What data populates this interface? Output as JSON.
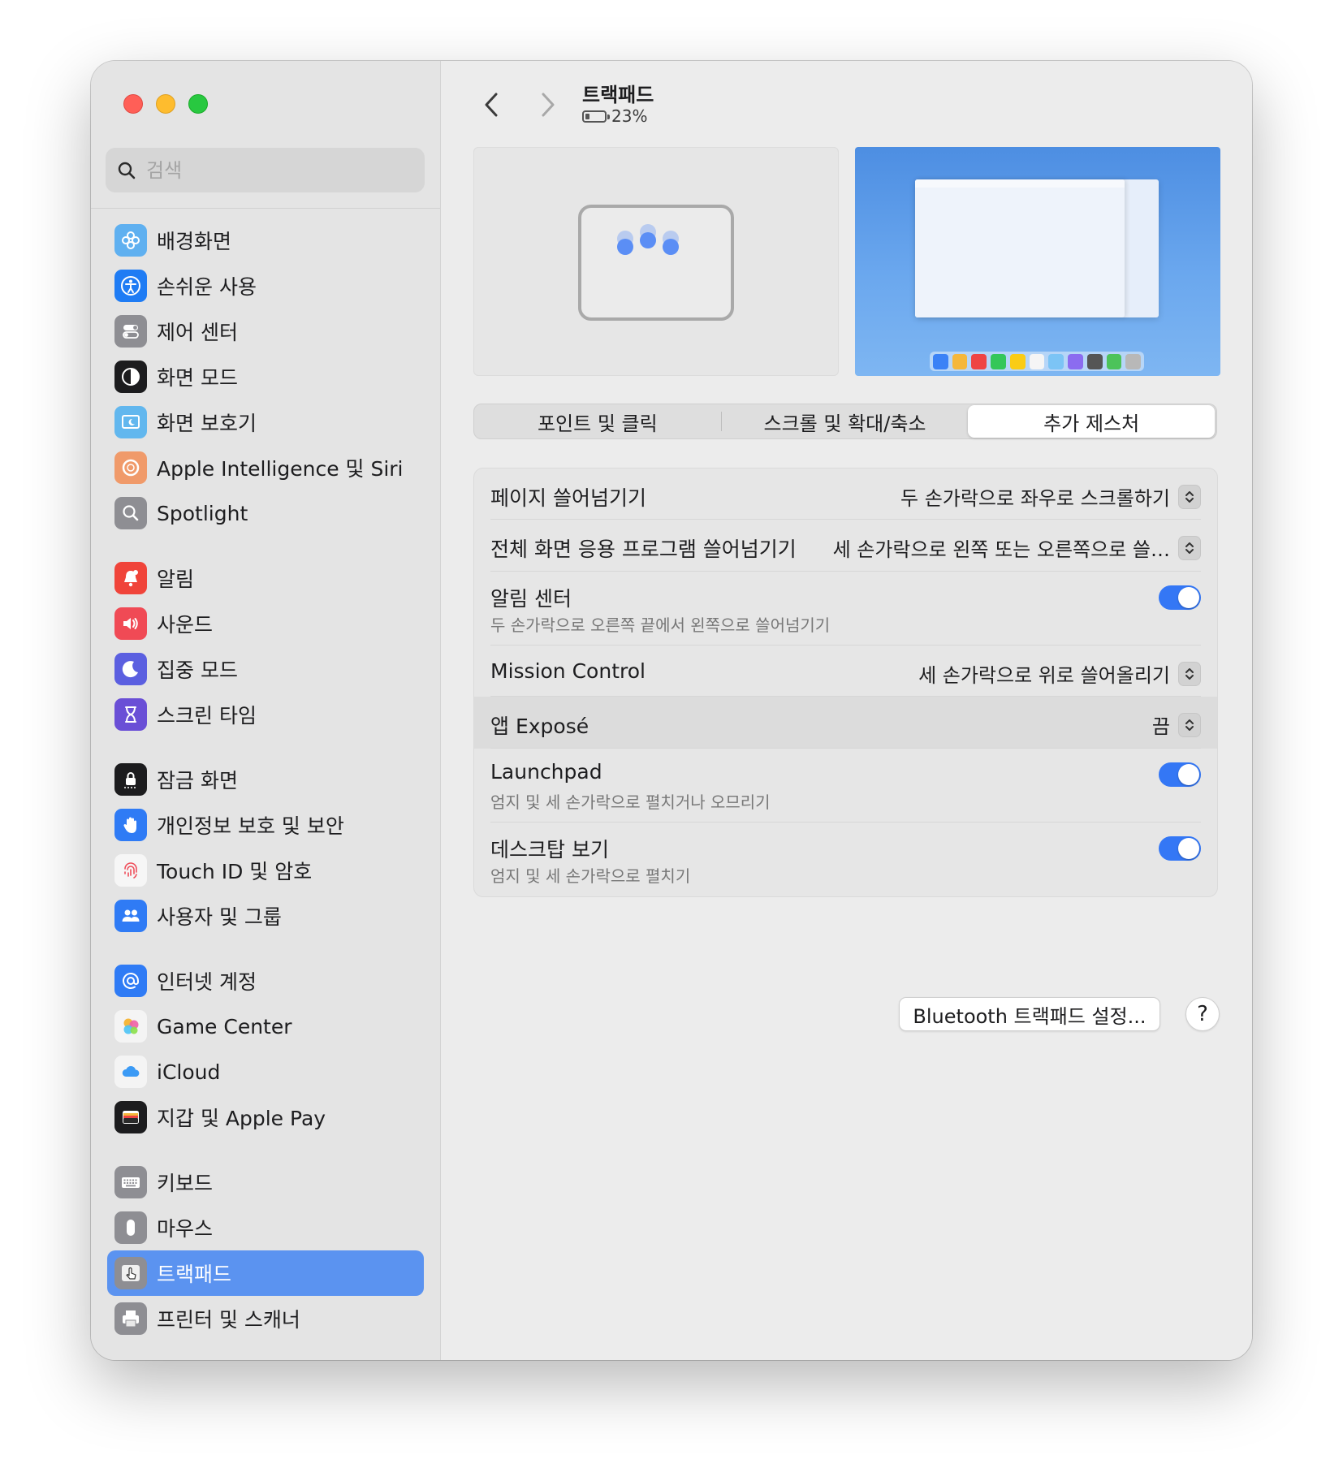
{
  "window": {
    "title": "트랙패드",
    "battery": "23%",
    "battery_level": 0.23
  },
  "search": {
    "placeholder": "검색"
  },
  "sidebar": {
    "groups": [
      [
        {
          "label": "배경화면",
          "icon": "wallpaper-icon",
          "color": "#5fb0f0"
        },
        {
          "label": "손쉬운 사용",
          "icon": "accessibility-icon",
          "color": "#1f7cf4"
        },
        {
          "label": "제어 센터",
          "icon": "control-center-icon",
          "color": "#8e8e93"
        },
        {
          "label": "화면 모드",
          "icon": "appearance-icon",
          "color": "#1c1c1e"
        },
        {
          "label": "화면 보호기",
          "icon": "screensaver-icon",
          "color": "#62b7ee"
        },
        {
          "label": "Apple Intelligence 및 Siri",
          "icon": "siri-icon",
          "color": "#f09a6a"
        },
        {
          "label": "Spotlight",
          "icon": "spotlight-icon",
          "color": "#8e8e93"
        }
      ],
      [
        {
          "label": "알림",
          "icon": "notifications-icon",
          "color": "#f0443a"
        },
        {
          "label": "사운드",
          "icon": "sound-icon",
          "color": "#f04a55"
        },
        {
          "label": "집중 모드",
          "icon": "focus-icon",
          "color": "#5b5fe0"
        },
        {
          "label": "스크린 타임",
          "icon": "screen-time-icon",
          "color": "#6a4fd6"
        }
      ],
      [
        {
          "label": "잠금 화면",
          "icon": "lock-screen-icon",
          "color": "#1c1c1e"
        },
        {
          "label": "개인정보 보호 및 보안",
          "icon": "privacy-hand-icon",
          "color": "#2f7bf5"
        },
        {
          "label": "Touch ID 및 암호",
          "icon": "fingerprint-icon",
          "color": "#f6f6f6"
        },
        {
          "label": "사용자 및 그룹",
          "icon": "users-icon",
          "color": "#2f7bf5"
        }
      ],
      [
        {
          "label": "인터넷 계정",
          "icon": "at-icon",
          "color": "#2f7bf5"
        },
        {
          "label": "Game Center",
          "icon": "game-center-icon",
          "color": "#f4f4f4"
        },
        {
          "label": "iCloud",
          "icon": "icloud-icon",
          "color": "#f4f4f4"
        },
        {
          "label": "지갑 및 Apple Pay",
          "icon": "wallet-icon",
          "color": "#1c1c1e"
        }
      ],
      [
        {
          "label": "키보드",
          "icon": "keyboard-icon",
          "color": "#8e8e93"
        },
        {
          "label": "마우스",
          "icon": "mouse-icon",
          "color": "#8e8e93"
        },
        {
          "label": "트랙패드",
          "icon": "trackpad-icon",
          "color": "#8e8e93",
          "selected": true
        },
        {
          "label": "프린터 및 스캐너",
          "icon": "printer-icon",
          "color": "#8e8e93"
        }
      ]
    ]
  },
  "tabs": [
    {
      "label": "포인트 및 클릭",
      "active": false
    },
    {
      "label": "스크롤 및 확대/축소",
      "active": false
    },
    {
      "label": "추가 제스처",
      "active": true
    }
  ],
  "settings": [
    {
      "label": "페이지 쓸어넘기기",
      "type": "popup",
      "value": "두 손가락으로 좌우로 스크롤하기"
    },
    {
      "label": "전체 화면 응용 프로그램 쓸어넘기기",
      "type": "popup",
      "value": "세 손가락으로 왼쪽 또는 오른쪽으로 쓸…"
    },
    {
      "label": "알림 센터",
      "type": "toggle",
      "on": true,
      "subtitle": "두 손가락으로 오른쪽 끝에서 왼쪽으로 쓸어넘기기"
    },
    {
      "label": "Mission Control",
      "type": "popup",
      "value": "세 손가락으로 위로 쓸어올리기"
    },
    {
      "label": "앱 Exposé",
      "type": "popup",
      "value": "끔"
    },
    {
      "label": "Launchpad",
      "type": "toggle",
      "on": true,
      "subtitle": "엄지 및 세 손가락으로 펼치거나 오므리기"
    },
    {
      "label": "데스크탑 보기",
      "type": "toggle",
      "on": true,
      "subtitle": "엄지 및 세 손가락으로 펼치기"
    }
  ],
  "buttons": {
    "bluetooth": "Bluetooth 트랙패드 설정...",
    "help": "?"
  },
  "colors": {
    "accent": "#3477f5",
    "selection": "#5b93f0"
  },
  "dock_colors": [
    "#3b82f6",
    "#f5b73b",
    "#ef4444",
    "#34c759",
    "#facc15",
    "#f5f5f5",
    "#7cc4f5",
    "#8b6cf0",
    "#555555",
    "#4cc35a",
    "#b8b8b8"
  ]
}
